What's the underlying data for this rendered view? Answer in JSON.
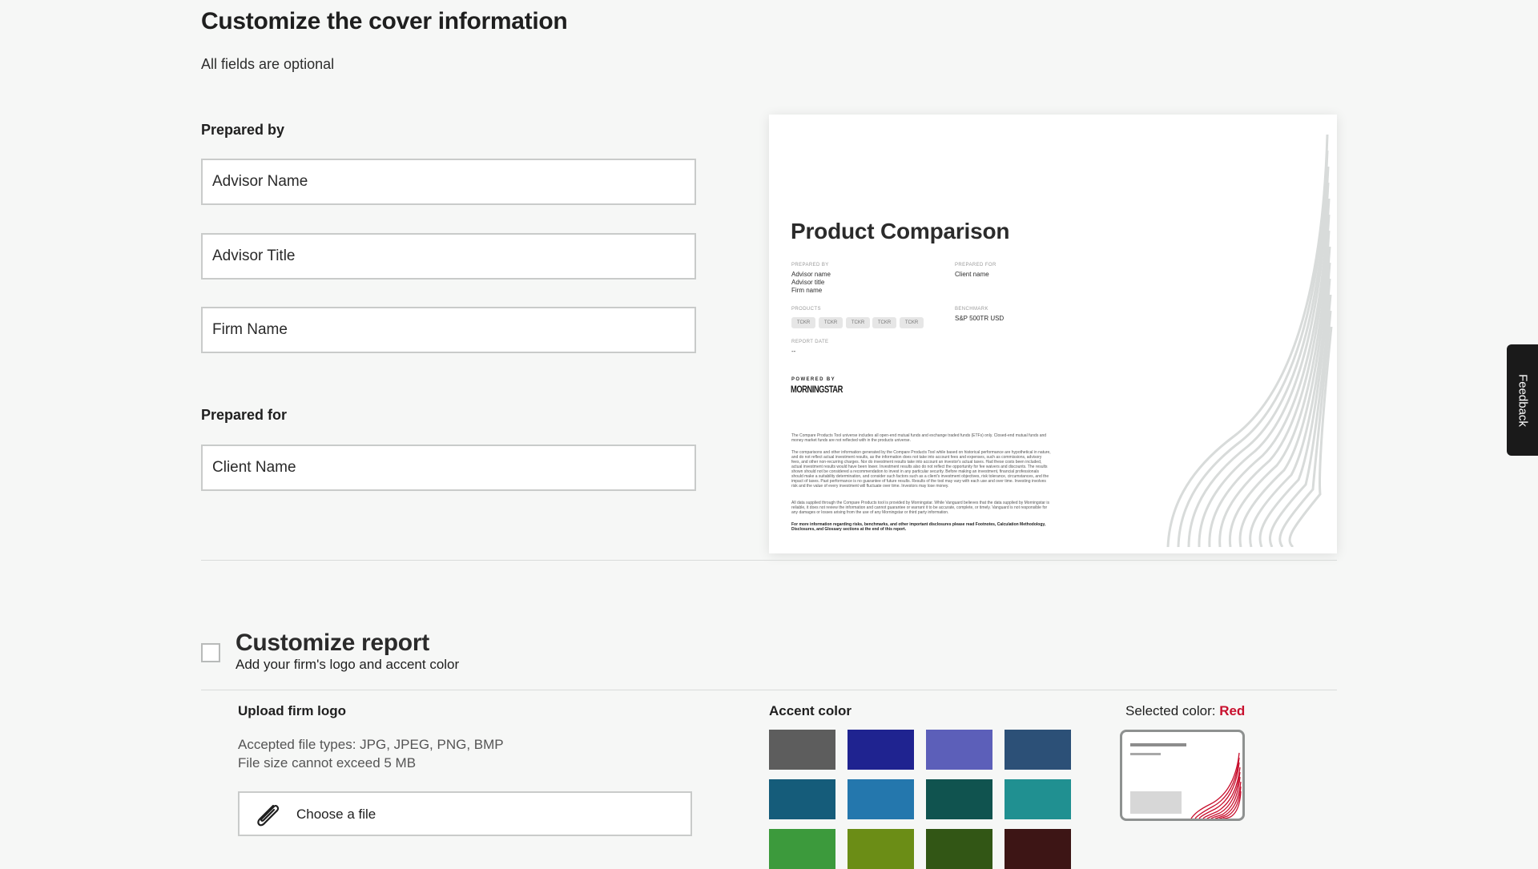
{
  "cover": {
    "title": "Customize the cover information",
    "subtitle": "All fields are optional",
    "prepared_by_label": "Prepared by",
    "prepared_for_label": "Prepared for",
    "fields": {
      "advisor_name": "Advisor Name",
      "advisor_title": "Advisor Title",
      "firm_name": "Firm Name",
      "client_name": "Client Name"
    }
  },
  "preview": {
    "title": "Product Comparison",
    "prepared_by_caption": "PREPARED BY",
    "prepared_by_lines": [
      "Advisor name",
      "Advisor title",
      "Firm name"
    ],
    "prepared_for_caption": "PREPARED FOR",
    "client_name": "Client name",
    "products_caption": "PRODUCTS",
    "tickers": [
      "TCKR",
      "TCKR",
      "TCKR",
      "TCKR",
      "TCKR"
    ],
    "benchmark_caption": "BENCHMARK",
    "benchmark": "S&P 500TR USD",
    "report_date_caption": "REPORT DATE",
    "report_date": "--",
    "powered_by": "POWERED BY",
    "brand": "MORNINGSTAR",
    "disclaimer_1": "The Compare Products Tool universe includes all open-end mutual funds and exchange traded funds (ETFs) only. Closed-end mutual funds and money market funds are not reflected with in the products universe.",
    "disclaimer_2": "The comparisons and other information generated by the Compare Products Tool while based on historical performance are hypothetical in nature, and do not reflect actual investment results, as the information does not take into account fees and expenses, such as commissions, advisory fees, and other non-recurring charges. Nor do investment results take into account an investor's actual taxes. Had these costs been included, actual investment results would have been lower. Investment results also do not reflect the opportunity for fee waivers and discounts. The results shown should not be considered a recommendation to invest in any particular security. Before making an investment, financial professionals should make a suitability determination, and consider such factors such as a client's investment objectives, risk tolerance, circumstances, and the impact of taxes. Past performance is no guarantee of future results. Results of the tool may vary with each use and over time. Investing involves risk and the value of every investment will fluctuate over time. Investors may lose money.",
    "disclaimer_3": "All data supplied through the Compare Products tool is provided by Morningstar. While Vanguard believes that the data supplied by Morningstar is reliable, it does not review the information and cannot guarantee or warrant it to be accurate, complete, or timely. Vanguard is not responsible for any damages or losses arising from the use of any Morningstar or third party information.",
    "disclaimer_bold": "For more information regarding risks, benchmarks, and other important disclosures please read Footnotes, Calculation Methodology, Disclosures, and Glossary sections at the end of this report."
  },
  "report": {
    "title": "Customize report",
    "subtitle": "Add your firm's logo and accent color",
    "checked": false,
    "upload_label": "Upload firm logo",
    "accepted_types": "Accepted file types: JPG, JPEG, PNG, BMP",
    "size_limit": "File size cannot exceed 5 MB",
    "choose_file": "Choose a file",
    "accent_label": "Accent color",
    "selected_label": "Selected color: ",
    "selected_value": "Red",
    "selected_hex": "#c8102e",
    "swatches": [
      "#5d5d5d",
      "#1f2390",
      "#5c5fb9",
      "#2c5077",
      "#155c7a",
      "#2477ad",
      "#10534f",
      "#209091",
      "#3c9a3c",
      "#6b8d16",
      "#325615",
      "#3d1515"
    ]
  },
  "feedback": "Feedback"
}
